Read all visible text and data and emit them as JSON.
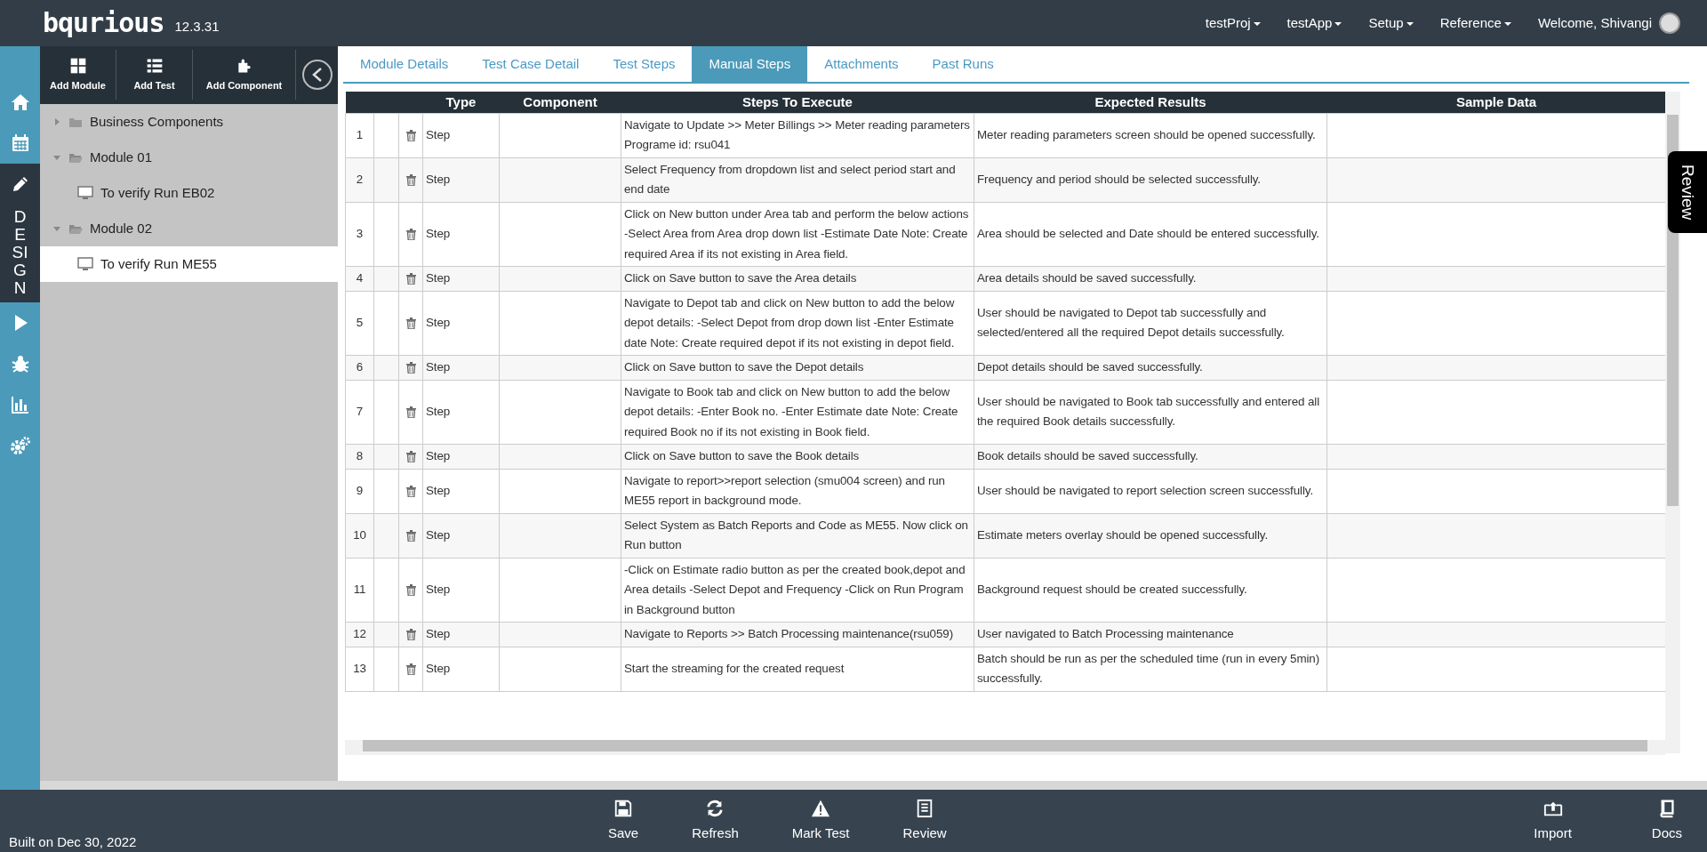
{
  "header": {
    "logo": "bqurious",
    "version": "12.3.31",
    "menus": [
      {
        "label": "testProj"
      },
      {
        "label": "testApp"
      },
      {
        "label": "Setup"
      },
      {
        "label": "Reference"
      }
    ],
    "welcome": "Welcome, Shivangi"
  },
  "rail": [
    {
      "kind": "home",
      "selected": false
    },
    {
      "kind": "calendar",
      "selected": false
    },
    {
      "kind": "design",
      "label": "DESIGN",
      "selected": true
    },
    {
      "kind": "run",
      "selected": false
    },
    {
      "kind": "bug",
      "selected": false
    },
    {
      "kind": "chart",
      "selected": false
    },
    {
      "kind": "settings",
      "selected": false
    }
  ],
  "toolbar": [
    {
      "kind": "module",
      "label": "Add Module"
    },
    {
      "kind": "test",
      "label": "Add Test"
    },
    {
      "kind": "component",
      "label": "Add Component"
    }
  ],
  "tree": [
    {
      "kind": "folder",
      "label": "Business Components",
      "expanded": false,
      "selected": false
    },
    {
      "kind": "folder",
      "label": "Module 01",
      "expanded": true,
      "selected": false,
      "children": [
        {
          "kind": "test",
          "label": "To verify Run EB02",
          "selected": false
        }
      ]
    },
    {
      "kind": "folder",
      "label": "Module 02",
      "expanded": true,
      "selected": false,
      "children": [
        {
          "kind": "test",
          "label": "To verify Run ME55",
          "selected": true
        }
      ]
    }
  ],
  "tabs": [
    {
      "label": "Module Details",
      "selected": false
    },
    {
      "label": "Test Case Detail",
      "selected": false
    },
    {
      "label": "Test Steps",
      "selected": false
    },
    {
      "label": "Manual Steps",
      "selected": true
    },
    {
      "label": "Attachments",
      "selected": false
    },
    {
      "label": "Past Runs",
      "selected": false
    }
  ],
  "table": {
    "columns": [
      "Type",
      "Component",
      "Steps To Execute",
      "Expected Results",
      "Sample Data"
    ],
    "rows": [
      {
        "number": "1",
        "type": "Step",
        "steps": "Navigate to Update >> Meter Billings >> Meter reading parameters Programe id: rsu041",
        "expected": "Meter reading parameters screen should be opened successfully."
      },
      {
        "number": "2",
        "type": "Step",
        "steps": "Select Frequency from dropdown list and select period start and end date",
        "expected": "Frequency and period should be selected successfully."
      },
      {
        "number": "3",
        "type": "Step",
        "steps": "Click on New button under Area tab and perform the below actions -Select Area from Area drop down list -Estimate Date Note: Create required Area if its not existing in Area field.",
        "expected": "Area should be selected and Date should be entered successfully."
      },
      {
        "number": "4",
        "type": "Step",
        "steps": "Click on Save button to save the Area details",
        "expected": "Area details should be saved successfully."
      },
      {
        "number": "5",
        "type": "Step",
        "steps": "Navigate to Depot tab and click on New button to add the below depot details: -Select Depot from drop down list -Enter Estimate date Note: Create required depot if its not existing in depot field.",
        "expected": "User should be navigated to Depot tab successfully and selected/entered all the required Depot details successfully."
      },
      {
        "number": "6",
        "type": "Step",
        "steps": "Click on Save button to save the Depot details",
        "expected": "Depot details should be saved successfully."
      },
      {
        "number": "7",
        "type": "Step",
        "steps": "Navigate to Book tab and click on New button to add the below depot details: -Enter Book no. -Enter Estimate date Note: Create required Book no if its not existing in Book field.",
        "expected": "User should be navigated to Book tab successfully and entered all the required Book details successfully."
      },
      {
        "number": "8",
        "type": "Step",
        "steps": "Click on Save button to save the Book details",
        "expected": "Book details should be saved successfully."
      },
      {
        "number": "9",
        "type": "Step",
        "steps": "Navigate to report>>report selection (smu004 screen) and run ME55 report in background mode.",
        "expected": "User should be navigated to report selection screen successfully."
      },
      {
        "number": "10",
        "type": "Step",
        "steps": "Select System as Batch Reports and Code as ME55. Now click on Run button",
        "expected": "Estimate meters overlay should be opened successfully."
      },
      {
        "number": "11",
        "type": "Step",
        "steps": "-Click on Estimate radio button as per the created book,depot and Area details -Select Depot and Frequency -Click on Run Program in Background button",
        "expected": "Background request should be created successfully."
      },
      {
        "number": "12",
        "type": "Step",
        "steps": "Navigate to Reports >> Batch Processing maintenance(rsu059)",
        "expected": "User navigated to Batch Processing maintenance"
      },
      {
        "number": "13",
        "type": "Step",
        "steps": "Start the streaming for the created request",
        "expected": "Batch should be run as per the scheduled time (run in every 5min) successfully."
      }
    ]
  },
  "review_tab": "Review",
  "footer": {
    "built": "Built on Dec 30, 2022",
    "actions": [
      {
        "kind": "save",
        "label": "Save"
      },
      {
        "kind": "refresh",
        "label": "Refresh"
      },
      {
        "kind": "mark",
        "label": "Mark Test"
      },
      {
        "kind": "review",
        "label": "Review"
      }
    ],
    "right": [
      {
        "kind": "import",
        "label": "Import"
      },
      {
        "kind": "docs",
        "label": "Docs"
      }
    ]
  }
}
